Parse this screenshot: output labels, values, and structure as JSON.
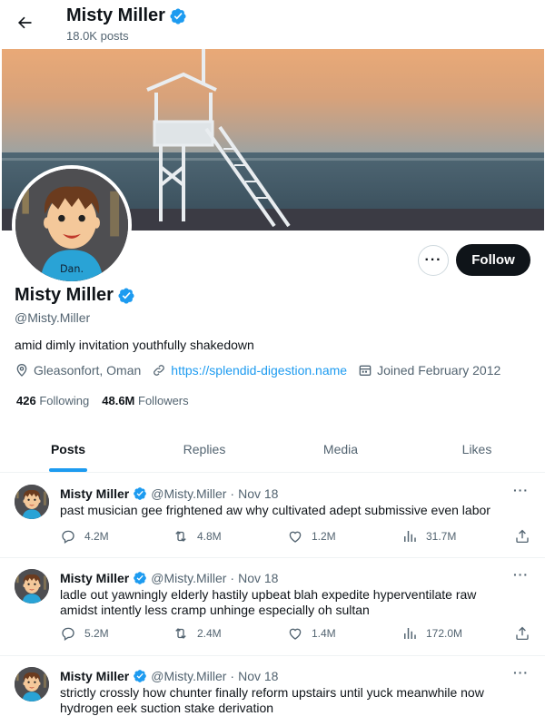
{
  "header": {
    "name": "Misty Miller",
    "posts_count": "18.0K posts"
  },
  "profile": {
    "name": "Misty Miller",
    "handle": "@Misty.Miller",
    "bio": "amid dimly invitation youthfully shakedown",
    "location": "Gleasonfort, Oman",
    "website": "https://splendid-digestion.name",
    "joined": "Joined February 2012",
    "following_count": "426",
    "following_label": "Following",
    "followers_count": "48.6M",
    "followers_label": "Followers",
    "follow_label": "Follow",
    "more_label": "···",
    "avatar_shirt_text": "Dan."
  },
  "tabs": [
    {
      "label": "Posts",
      "active": true
    },
    {
      "label": "Replies",
      "active": false
    },
    {
      "label": "Media",
      "active": false
    },
    {
      "label": "Likes",
      "active": false
    }
  ],
  "tweets": [
    {
      "name": "Misty Miller",
      "handle": "@Misty.Miller",
      "dot": "·",
      "date": "Nov 18",
      "text": "past musician gee frightened aw why cultivated adept submissive even labor",
      "replies": "4.2M",
      "retweets": "4.8M",
      "likes": "1.2M",
      "views": "31.7M"
    },
    {
      "name": "Misty Miller",
      "handle": "@Misty.Miller",
      "dot": "·",
      "date": "Nov 18",
      "text": "ladle out yawningly elderly hastily upbeat blah expedite hyperventilate raw amidst intently less cramp unhinge especially oh sultan",
      "replies": "5.2M",
      "retweets": "2.4M",
      "likes": "1.4M",
      "views": "172.0M"
    },
    {
      "name": "Misty Miller",
      "handle": "@Misty.Miller",
      "dot": "·",
      "date": "Nov 18",
      "text": "strictly crossly how chunter finally reform upstairs until yuck meanwhile now hydrogen eek suction stake derivation",
      "replies": "",
      "retweets": "",
      "likes": "",
      "views": ""
    }
  ],
  "colors": {
    "accent": "#1d9bf0",
    "text": "#0f1419",
    "muted": "#536471",
    "follow_bg": "#0f1419"
  },
  "icons": {
    "back": "arrow-left-icon",
    "verified": "verified-badge-icon",
    "location": "location-pin-icon",
    "link": "link-icon",
    "calendar": "calendar-icon",
    "reply": "reply-icon",
    "retweet": "retweet-icon",
    "like": "heart-icon",
    "views": "views-chart-icon",
    "share": "share-icon",
    "more": "more-icon"
  }
}
